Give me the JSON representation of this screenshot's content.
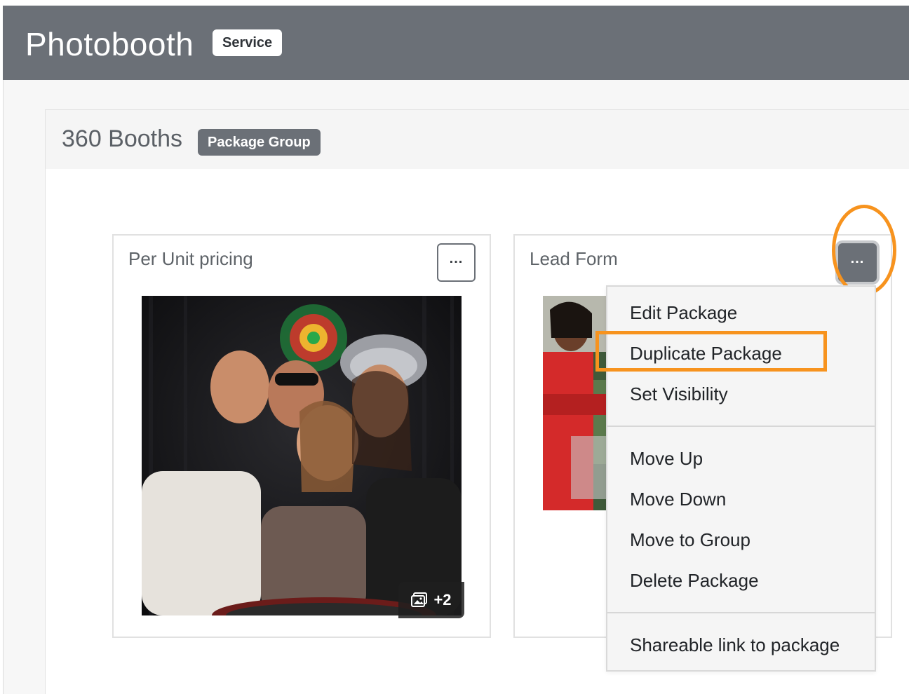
{
  "service": {
    "title": "Photobooth",
    "badge": "Service"
  },
  "group": {
    "title": "360 Booths",
    "badge": "Package Group"
  },
  "packages": [
    {
      "title": "Per Unit pricing",
      "more_icon": "ellipsis-icon",
      "gallery_count": "+2",
      "gallery_icon": "image-gallery-icon"
    },
    {
      "title": "Lead Form",
      "more_icon": "ellipsis-icon"
    }
  ],
  "menu": {
    "items": [
      "Edit Package",
      "Duplicate Package",
      "Set Visibility",
      "Move Up",
      "Move Down",
      "Move to Group",
      "Delete Package",
      "Shareable link to package"
    ]
  },
  "colors": {
    "header_bg": "#6b7077",
    "highlight": "#f7931e",
    "menu_bg": "#f5f5f5"
  }
}
